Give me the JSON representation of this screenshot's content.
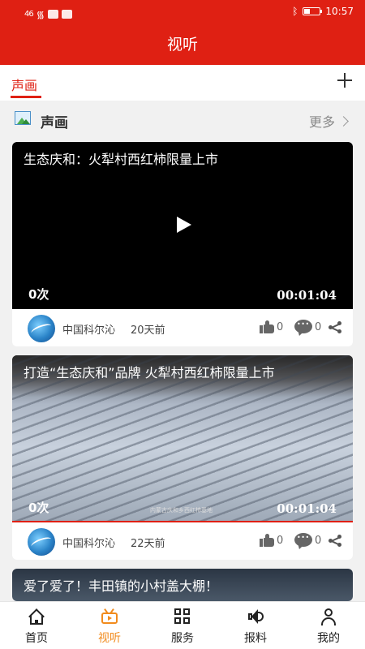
{
  "status_bar": {
    "signal": "46",
    "time": "10:57"
  },
  "header": {
    "title": "视听"
  },
  "tabs": {
    "active_label": "声画"
  },
  "section": {
    "title": "声画",
    "more_label": "更多"
  },
  "cards": [
    {
      "title": "生态庆和：火犁村西红柿限量上市",
      "views": "0次",
      "duration": "00:01:04",
      "source": "中国科尔沁",
      "ago": "20天前",
      "likes": "0",
      "comments": "0"
    },
    {
      "title": "打造“生态庆和”品牌 火犁村西红柿限量上市",
      "views": "0次",
      "duration": "00:01:04",
      "caption": "内蒙古庆和乡西红柿基地",
      "source": "中国科尔沁",
      "ago": "22天前",
      "likes": "0",
      "comments": "0"
    },
    {
      "title": "爱了爱了！丰田镇的小村盖大棚！"
    }
  ],
  "bottom_nav": {
    "items": [
      {
        "label": "首页",
        "icon": "home-icon"
      },
      {
        "label": "视听",
        "icon": "tv-icon",
        "active": true
      },
      {
        "label": "服务",
        "icon": "grid-icon"
      },
      {
        "label": "报料",
        "icon": "speaker-icon"
      },
      {
        "label": "我的",
        "icon": "user-icon"
      }
    ]
  },
  "colors": {
    "brand_red": "#df2013",
    "active_orange": "#f18b1d"
  }
}
